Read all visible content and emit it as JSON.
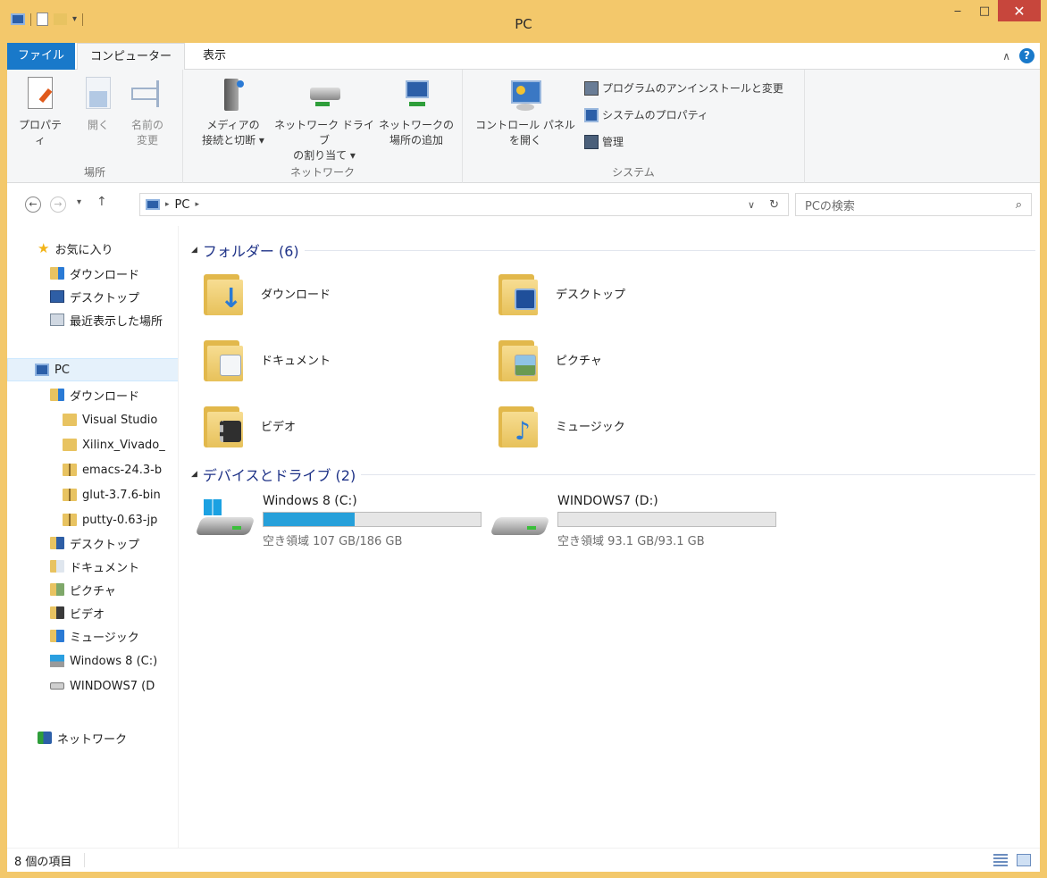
{
  "window": {
    "title": "PC",
    "minimize_label": "‒",
    "maximize_label": "□",
    "close_label": "✕"
  },
  "tabs": {
    "file": "ファイル",
    "computer": "コンピューター",
    "view": "表示"
  },
  "ribbon": {
    "location_group": {
      "label": "場所",
      "properties": "プロパティ",
      "open": "開く",
      "rename_line1": "名前の",
      "rename_line2": "変更"
    },
    "network_group": {
      "label": "ネットワーク",
      "media_line1": "メディアの",
      "media_line2": "接続と切断 ▾",
      "map_drive_line1": "ネットワーク ドライブ",
      "map_drive_line2": "の割り当て ▾",
      "add_location_line1": "ネットワークの",
      "add_location_line2": "場所の追加"
    },
    "system_group": {
      "label": "システム",
      "control_panel_line1": "コントロール パネル",
      "control_panel_line2": "を開く",
      "uninstall": "プログラムのアンインストールと変更",
      "system_properties": "システムのプロパティ",
      "manage": "管理"
    }
  },
  "address": {
    "path_item": "PC",
    "search_placeholder": "PCの検索"
  },
  "nav": {
    "favorites": "お気に入り",
    "fav_downloads": "ダウンロード",
    "fav_desktop": "デスクトップ",
    "fav_recent": "最近表示した場所",
    "pc": "PC",
    "downloads": "ダウンロード",
    "dl_children": [
      "Visual Studio",
      "Xilinx_Vivado_",
      "emacs-24.3-b",
      "glut-3.7.6-bin",
      "putty-0.63-jp"
    ],
    "desktop": "デスクトップ",
    "documents": "ドキュメント",
    "pictures": "ピクチャ",
    "videos": "ビデオ",
    "music": "ミュージック",
    "drive_c": "Windows 8 (C:)",
    "drive_d": "WINDOWS7 (D",
    "network": "ネットワーク"
  },
  "content": {
    "folders_header": "フォルダー (6)",
    "folders": [
      "ダウンロード",
      "デスクトップ",
      "ドキュメント",
      "ピクチャ",
      "ビデオ",
      "ミュージック"
    ],
    "devices_header": "デバイスとドライブ (2)",
    "drives": [
      {
        "name": "Windows 8 (C:)",
        "free": "空き領域 107 GB/186 GB",
        "used_fraction": 0.42
      },
      {
        "name": "WINDOWS7 (D:)",
        "free": "空き領域 93.1 GB/93.1 GB",
        "used_fraction": 0.0
      }
    ]
  },
  "status": {
    "item_count": "8 個の項目"
  },
  "colors": {
    "accent": "#1979ca",
    "title_bar": "#f3c86b",
    "drive_fill": "#26a0da",
    "header_text": "#1e3287"
  }
}
